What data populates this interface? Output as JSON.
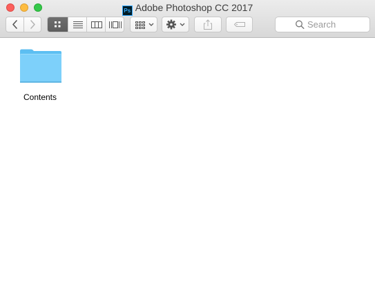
{
  "window": {
    "title": "Adobe Photoshop CC 2017",
    "app_icon_text": "Ps"
  },
  "toolbar": {
    "nav": [
      "back-icon",
      "forward-icon"
    ],
    "views": [
      "icon-view-icon",
      "list-view-icon",
      "column-view-icon",
      "cover-flow-icon"
    ],
    "active_view": "icon-view-icon",
    "arrange_icon": "arrange-icon",
    "action_icon": "gear-icon",
    "share_icon": "share-icon",
    "tags_icon": "tag-icon"
  },
  "search": {
    "placeholder": "Search"
  },
  "content": {
    "items": [
      {
        "name": "Contents",
        "kind": "folder"
      }
    ]
  },
  "colors": {
    "close": "#fc605c",
    "minimize": "#fdbc40",
    "maximize": "#34c84a",
    "folder": "#6ecdf7"
  }
}
